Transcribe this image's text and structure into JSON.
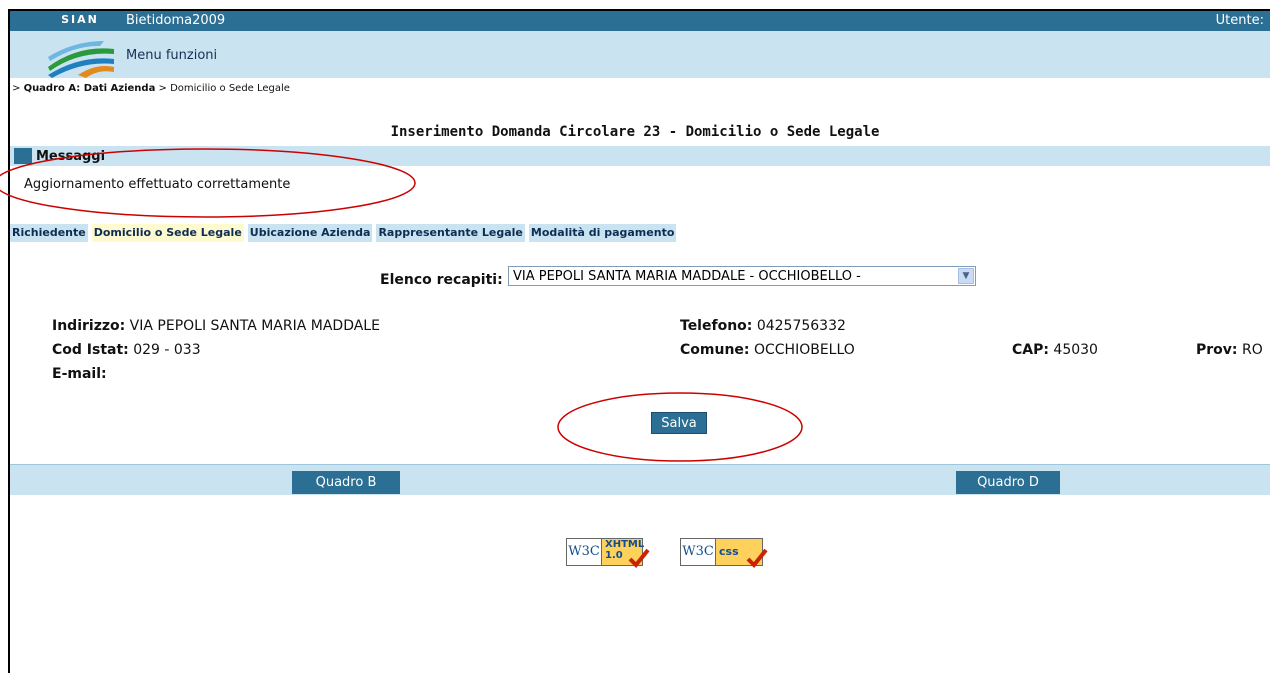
{
  "header": {
    "logo_text": "SIAN",
    "app_title": "Bietidoma2009",
    "menu_label": "Menu funzioni",
    "user_label": "Utente: "
  },
  "breadcrumb": {
    "prefix": "> ",
    "current_section": "Quadro A: Dati Azienda",
    "separator": " > ",
    "current_page": "Domicilio o Sede Legale"
  },
  "page": {
    "title": "Inserimento Domanda Circolare 23 - Domicilio o Sede Legale"
  },
  "messages": {
    "title": "Messaggi",
    "text": "Aggiornamento effettuato correttamente"
  },
  "tabs": [
    {
      "label": "Richiedente",
      "active": false
    },
    {
      "label": "Domicilio o Sede Legale",
      "active": true
    },
    {
      "label": "Ubicazione Azienda",
      "active": false
    },
    {
      "label": "Rappresentante Legale",
      "active": false
    },
    {
      "label": "Modalità di pagamento",
      "active": false
    }
  ],
  "recapiti": {
    "label": "Elenco recapiti:",
    "selected": "VIA PEPOLI SANTA MARIA MADDALE - OCCHIOBELLO -"
  },
  "fields": {
    "indirizzo_label": "Indirizzo:",
    "indirizzo_value": "VIA PEPOLI SANTA MARIA MADDALE",
    "telefono_label": "Telefono:",
    "telefono_value": "0425756332",
    "cod_istat_label": "Cod Istat:",
    "cod_istat_value": "029 - 033",
    "comune_label": "Comune:",
    "comune_value": "OCCHIOBELLO",
    "cap_label": "CAP:",
    "cap_value": "45030",
    "prov_label": "Prov:",
    "prov_value": "RO",
    "email_label": "E-mail:",
    "email_value": ""
  },
  "buttons": {
    "save": "Salva",
    "quadro_b": "Quadro B",
    "quadro_d": "Quadro D"
  },
  "badges": {
    "w3c": "W3C",
    "xhtml_line1": "XHTML",
    "xhtml_line2": "1.0",
    "css": "css"
  },
  "colors": {
    "header_dark": "#2b6f94",
    "header_light": "#c9e3f0",
    "active_tab": "#fdfad0",
    "annotation_red": "#cc0000"
  }
}
